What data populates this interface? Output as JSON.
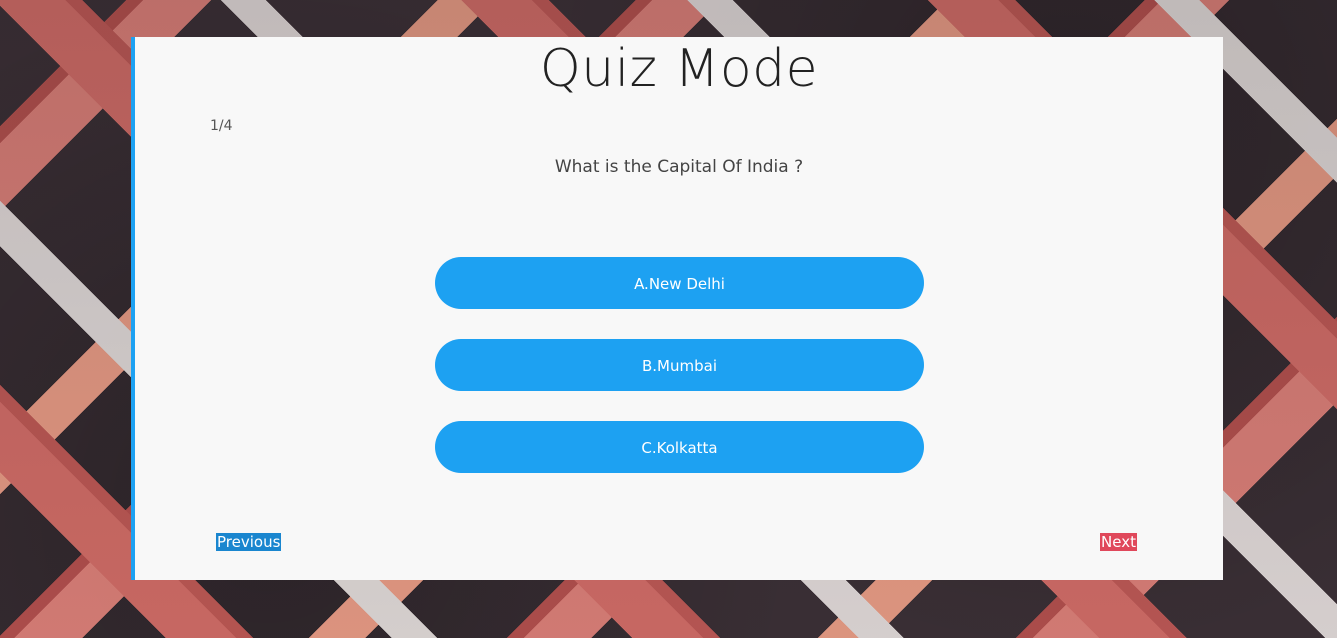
{
  "quiz": {
    "title": "Quiz Mode",
    "progress": "1/4",
    "question": "What is the Capital Of India ?",
    "options": [
      {
        "label": "A.New Delhi"
      },
      {
        "label": "B.Mumbai"
      },
      {
        "label": "C.Kolkatta"
      }
    ]
  },
  "navigation": {
    "previous_label": "Previous",
    "next_label": "Next"
  },
  "colors": {
    "accent": "#1da1f2",
    "previous_bg": "#1a86cf",
    "next_bg": "#e0485b",
    "card_bg": "#f8f8f8"
  }
}
